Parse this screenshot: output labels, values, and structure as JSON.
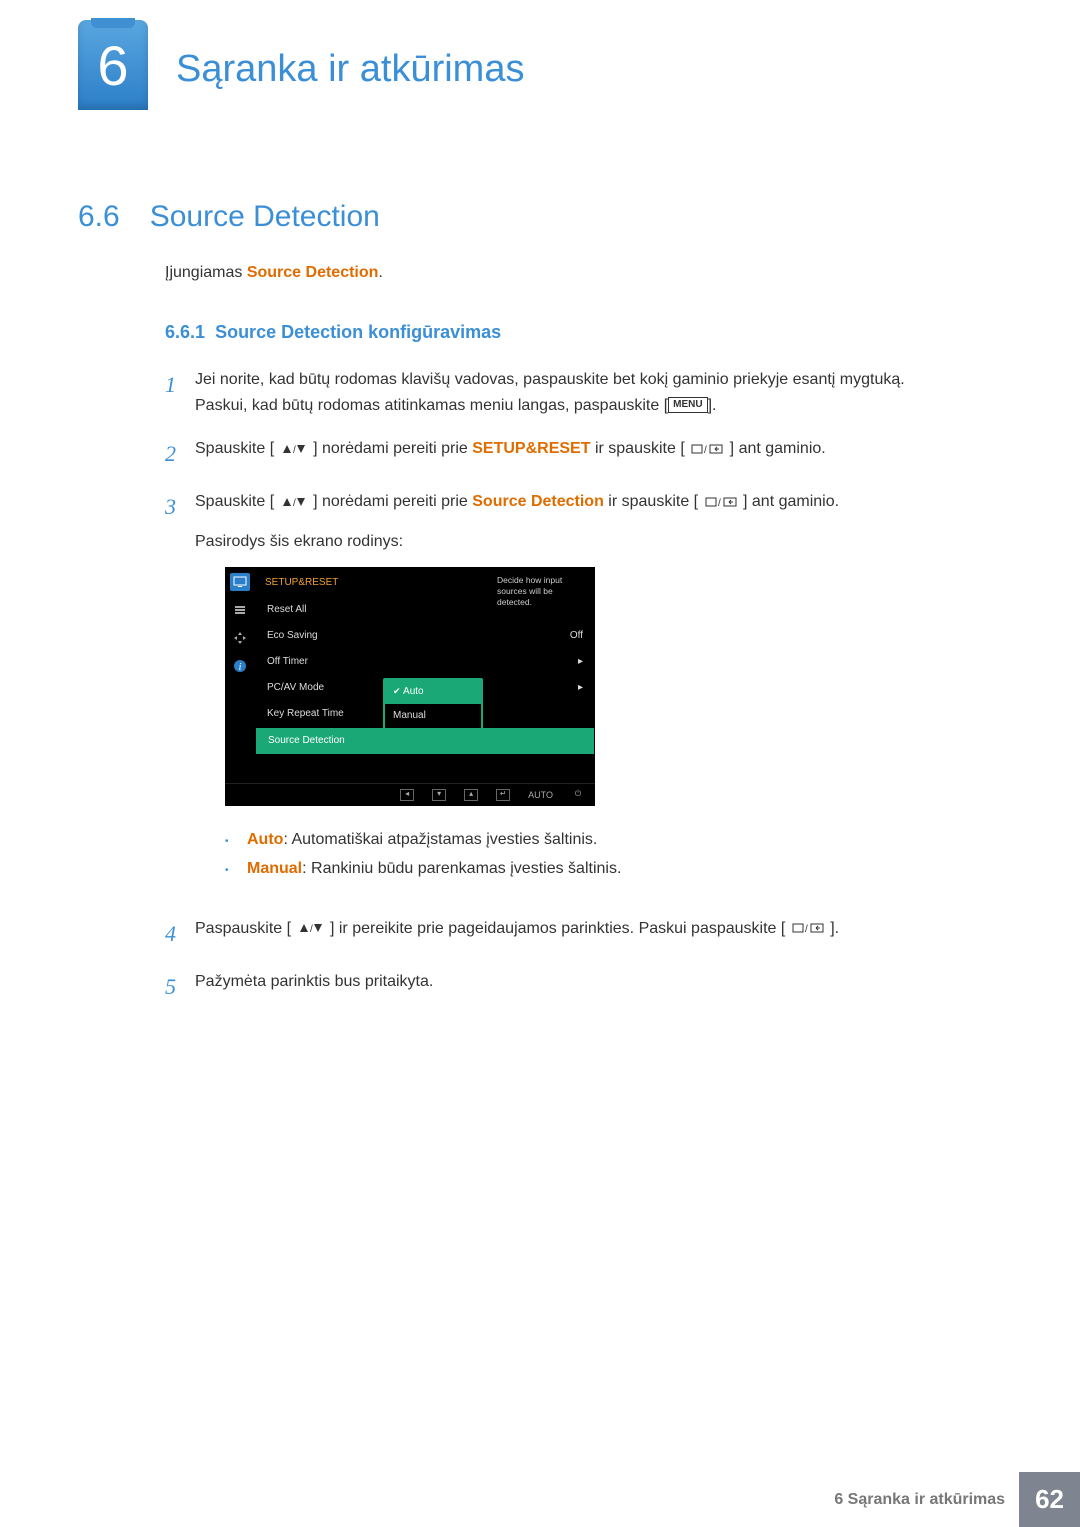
{
  "chapter": {
    "number": "6",
    "title": "Sąranka ir atkūrimas"
  },
  "section": {
    "number": "6.6",
    "title": "Source Detection"
  },
  "intro": {
    "pre": "Įjungiamas ",
    "highlight": "Source Detection",
    "post": "."
  },
  "subsection": {
    "number": "6.6.1",
    "title": "Source Detection konfigūravimas"
  },
  "steps": {
    "1": {
      "line1": "Jei norite, kad būtų rodomas klavišų vadovas, paspauskite bet kokį gaminio priekyje esantį mygtuką.",
      "line2_pre": "Paskui, kad būtų rodomas atitinkamas meniu langas, paspauskite [",
      "menu_label": "MENU",
      "line2_post": "]."
    },
    "2": {
      "pre": "Spauskite [",
      "mid1": "] norėdami pereiti prie ",
      "hl": "SETUP&RESET",
      "mid2": " ir spauskite [",
      "post": "] ant gaminio."
    },
    "3": {
      "pre": "Spauskite [",
      "mid1": "] norėdami pereiti prie ",
      "hl": "Source Detection",
      "mid2": " ir spauskite [",
      "post": "] ant gaminio.",
      "after": "Pasirodys šis ekrano rodinys:"
    },
    "4": {
      "pre": "Paspauskite [",
      "mid": "] ir pereikite prie pageidaujamos parinkties. Paskui paspauskite [",
      "post": "]."
    },
    "5": {
      "text": "Pažymėta parinktis bus pritaikyta."
    }
  },
  "osd": {
    "title": "SETUP&RESET",
    "help": "Decide how input sources will be detected.",
    "items": [
      {
        "label": "Reset All",
        "value": ""
      },
      {
        "label": "Eco Saving",
        "value": "Off"
      },
      {
        "label": "Off Timer",
        "value": "▸"
      },
      {
        "label": "PC/AV Mode",
        "value": "▸"
      },
      {
        "label": "Key Repeat Time",
        "value": ""
      },
      {
        "label": "Source Detection",
        "value": ""
      }
    ],
    "popup": {
      "opt1": "Auto",
      "opt2": "Manual"
    },
    "bottom": {
      "auto": "AUTO"
    }
  },
  "bullets": {
    "auto": {
      "hl": "Auto",
      "text": ": Automatiškai atpažįstamas įvesties šaltinis."
    },
    "manual": {
      "hl": "Manual",
      "text": ": Rankiniu būdu parenkamas įvesties šaltinis."
    }
  },
  "footer": {
    "text": "6 Sąranka ir atkūrimas",
    "page": "62"
  }
}
